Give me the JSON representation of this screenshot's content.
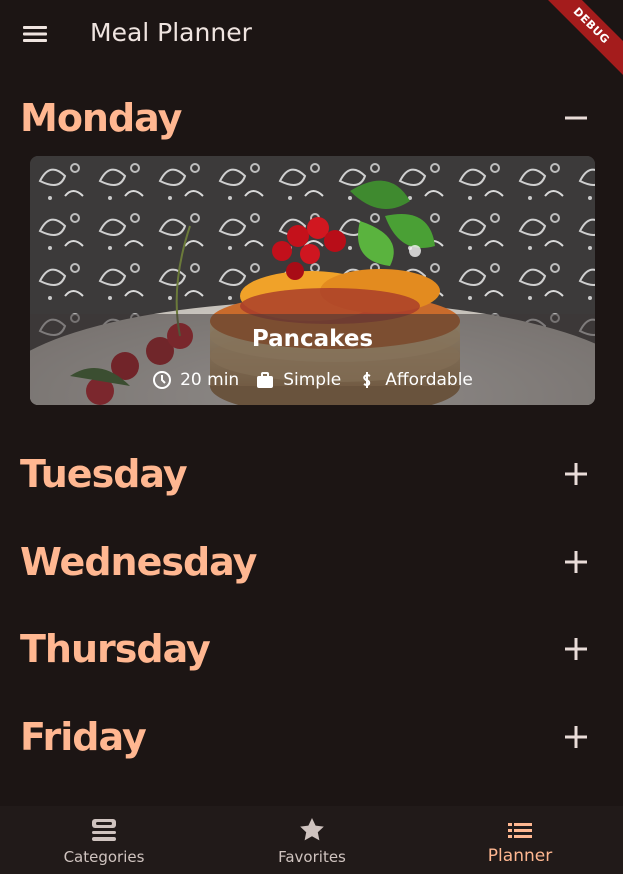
{
  "appbar": {
    "title": "Meal Planner",
    "debug_label": "DEBUG"
  },
  "days": [
    {
      "name": "Monday",
      "expanded": true
    },
    {
      "name": "Tuesday",
      "expanded": false
    },
    {
      "name": "Wednesday",
      "expanded": false
    },
    {
      "name": "Thursday",
      "expanded": false
    },
    {
      "name": "Friday",
      "expanded": false
    }
  ],
  "meal": {
    "title": "Pancakes",
    "duration": "20 min",
    "complexity": "Simple",
    "affordability": "Affordable"
  },
  "nav": {
    "items": [
      {
        "label": "Categories",
        "icon": "categories-icon"
      },
      {
        "label": "Favorites",
        "icon": "star-icon"
      },
      {
        "label": "Planner",
        "icon": "list-icon"
      }
    ],
    "active": "Planner"
  },
  "colors": {
    "background": "#1c1514",
    "accent": "#ffb791",
    "debug": "#a41c1c"
  }
}
